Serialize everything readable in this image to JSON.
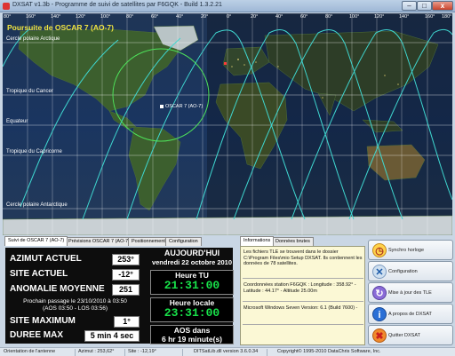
{
  "window": {
    "title": "DXSAT v1.3b - Programme de suivi de satellites par F6GQK - Build 1.3.2.21"
  },
  "map": {
    "title": "Poursuite de OSCAR 7 (AO-7)",
    "longitudes": [
      "80°",
      "160°",
      "140°",
      "120°",
      "100°",
      "80°",
      "60°",
      "40°",
      "20°",
      "0°",
      "20°",
      "40°",
      "60°",
      "80°",
      "100°",
      "120°",
      "140°",
      "160°",
      "180°"
    ],
    "lines": {
      "arctic": "Cercle polaire Arctique",
      "cancer": "Tropique du Cancer",
      "equator": "Equateur",
      "capricorn": "Tropique du Capricorne",
      "antarctic": "Cercle polaire Antarctique"
    },
    "satellite_label": "OSCAR 7 (AO-7)",
    "colors": {
      "track": "#3fd7d0",
      "footprint": "#4ee25a",
      "title": "#f2e640"
    }
  },
  "left_tabs": [
    {
      "label": "Suivi de OSCAR 7 (AO-7)",
      "active": true
    },
    {
      "label": "Prévisions OSCAR 7 (AO-7)",
      "active": false
    },
    {
      "label": "Positionnement",
      "active": false
    },
    {
      "label": "Configuration",
      "active": false
    }
  ],
  "tracking": {
    "azimut_label": "AZIMUT ACTUEL",
    "azimut_value": "253°",
    "site_label": "SITE ACTUEL",
    "site_value": "-12°",
    "anomalie_label": "ANOMALIE MOYENNE",
    "anomalie_value": "251",
    "next_pass_line1": "Prochain passage le 23/10/2010 à 03:50",
    "next_pass_line2": "(AOS 03:50 - LOS 03:56)",
    "site_max_label": "SITE MAXIMUM",
    "site_max_value": "1°",
    "duree_label": "DUREE MAX",
    "duree_value": "5 min 4 sec"
  },
  "today": {
    "title": "AUJOURD'HUI",
    "date": "vendredi 22 octobre 2010",
    "utc_label": "Heure TU",
    "utc_value": "21:31:00",
    "local_label": "Heure locale",
    "local_value": "23:31:00",
    "aos_label": "AOS dans",
    "aos_value": "6 hr 19 minute(s)"
  },
  "info_tabs": [
    {
      "label": "Informations",
      "active": true
    },
    {
      "label": "Données brutes",
      "active": false
    }
  ],
  "info": {
    "tle_text": "Les fichiers TLE se trouvent dans le dossier C:\\Program Files\\mio Setup DXSAT. Ils contiennent les données de 78 satellites.",
    "coords_text": "Coordonnées station F6GQK : Longitude : 358.92° - Latitude : 44.17° - Altitude 25.00m",
    "os_text": "Microsoft Windows Seven Version: 6.1 (Build 7600) -"
  },
  "buttons": [
    {
      "label": "Synchro horloge",
      "icon": "clock-icon"
    },
    {
      "label": "Configuration",
      "icon": "tools-icon"
    },
    {
      "label": "Mise à jour des TLE",
      "icon": "update-icon"
    },
    {
      "label": "A propos de DXSAT",
      "icon": "info-icon"
    },
    {
      "label": "Quitter DXSAT",
      "icon": "exit-icon"
    }
  ],
  "status": {
    "orientation": "Orientation de l'antenne",
    "azimut": "Azimut : 253,62°",
    "site": "Site : -12,19°",
    "dll": "DITSatLib.dll version 3.6.0.34",
    "copyright": "Copyright© 1995-2010 DataChris Software, Inc."
  }
}
